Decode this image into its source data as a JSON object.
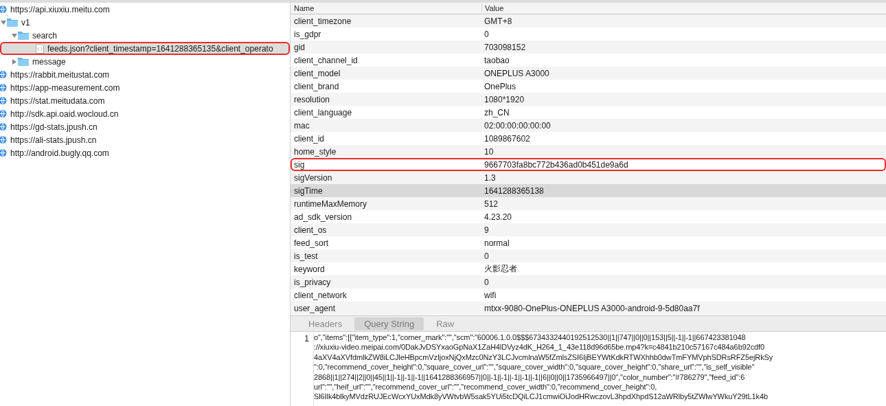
{
  "tree": [
    {
      "label": "https://api.xiuxiu.meitu.com",
      "kind": "host",
      "selected": false,
      "children": [
        {
          "label": "v1",
          "kind": "folder",
          "expanded": true,
          "selected": false,
          "children": [
            {
              "label": "search",
              "kind": "folder",
              "expanded": true,
              "selected": false,
              "children": [
                {
                  "label": "feeds.json?client_timestamp=1641288365135&client_operato",
                  "kind": "file",
                  "selected": true,
                  "highlighted": true
                }
              ]
            },
            {
              "label": "message",
              "kind": "folder",
              "expanded": false,
              "selected": false
            }
          ]
        }
      ]
    },
    {
      "label": "https://rabbit.meitustat.com",
      "kind": "host",
      "selected": false
    },
    {
      "label": "https://app-measurement.com",
      "kind": "host",
      "selected": false
    },
    {
      "label": "https://stat.meitudata.com",
      "kind": "host",
      "selected": false
    },
    {
      "label": "http://sdk.api.oaid.wocloud.cn",
      "kind": "host",
      "selected": false
    },
    {
      "label": "https://gd-stats.jpush.cn",
      "kind": "host",
      "selected": false
    },
    {
      "label": "https://ali-stats.jpush.cn",
      "kind": "host",
      "selected": false
    },
    {
      "label": "http://android.bugly.qq.com",
      "kind": "host",
      "selected": false
    }
  ],
  "table": {
    "columns": [
      "Name",
      "Value"
    ],
    "rows": [
      {
        "name": "client_timezone",
        "value": "GMT+8",
        "selected": false
      },
      {
        "name": "is_gdpr",
        "value": "0",
        "selected": false
      },
      {
        "name": "gid",
        "value": "703098152",
        "selected": false
      },
      {
        "name": "client_channel_id",
        "value": "taobao",
        "selected": false
      },
      {
        "name": "client_model",
        "value": "ONEPLUS A3000",
        "selected": false
      },
      {
        "name": "client_brand",
        "value": "OnePlus",
        "selected": false
      },
      {
        "name": "resolution",
        "value": "1080*1920",
        "selected": false
      },
      {
        "name": "client_language",
        "value": "zh_CN",
        "selected": false
      },
      {
        "name": "mac",
        "value": "02:00:00:00:00:00",
        "selected": false
      },
      {
        "name": "client_id",
        "value": "1089867602",
        "selected": false
      },
      {
        "name": "home_style",
        "value": "10",
        "selected": false
      },
      {
        "name": "sig",
        "value": "9667703fa8bc772b436ad0b451de9a6d",
        "selected": false,
        "highlighted": true
      },
      {
        "name": "sigVersion",
        "value": "1.3",
        "selected": false
      },
      {
        "name": "sigTime",
        "value": "1641288365138",
        "selected": true
      },
      {
        "name": "runtimeMaxMemory",
        "value": "512",
        "selected": false
      },
      {
        "name": "ad_sdk_version",
        "value": "4.23.20",
        "selected": false
      },
      {
        "name": "client_os",
        "value": "9",
        "selected": false
      },
      {
        "name": "feed_sort",
        "value": "normal",
        "selected": false
      },
      {
        "name": "is_test",
        "value": "0",
        "selected": false
      },
      {
        "name": "keyword",
        "value": "火影忍者",
        "selected": false
      },
      {
        "name": "is_privacy",
        "value": "0",
        "selected": false
      },
      {
        "name": "client_network",
        "value": "wifi",
        "selected": false
      },
      {
        "name": "user_agent",
        "value": "mtxx-9080-OnePlus-ONEPLUS A3000-android-9-5d80aa7f",
        "selected": false
      }
    ]
  },
  "tabs": [
    {
      "label": "Headers",
      "selected": false
    },
    {
      "label": "Query String",
      "selected": true
    },
    {
      "label": "Raw",
      "selected": false
    }
  ],
  "code": {
    "line_number": "1",
    "lines": [
      "o\",\"items\":[{\"item_type\":1,\"corner_mark\":\"\",\"scm\":\"60006.1.0.0$$$6734332440192512530||1||747||0||0||153||5||-1||-1||667423381048",
      "://xiuxiu-video.meipai.com/0DakJvDSYxaoGpNaX1ZaH4lDVyz4dK_H264_1_43e118d96d65be.mp4?k=c4841b210c57167c484a6b92cdf0",
      "4aXV4aXVfdmlkZW8iLCJleHBpcmVzIjoxNjQxMzc0NzY3LCJvcmlnaW5fZmlsZSI6IjBEYWtKdkRTWXhhb0dwTmFYMVphSDRsRFZ5ejRkSy",
      "\":0,\"recommend_cover_height\":0,\"square_cover_url\":\"\",\"square_cover_width\":0,\"square_cover_height\":0,\"share_url\":\"\",\"is_self_visible\"",
      "2868||1||274||2||0||45||1||-1||-1||-1||1641288366957||0||-1||-1||-1||-1||-1||6||0||0||1735966497||0\",\"color_number\":\"#786279\",\"feed_id\":6",
      "url\":\"\",\"heif_url\":\"\",\"recommend_cover_url\":\"\",\"recommend_cover_width\":0,\"recommend_cover_height\":0,",
      "Sl6Ilk4blkyMVdzRUJEcWcxYUxMdk8yVWtvbW5sak5YUi5tcDQiLCJ1cmwiOiJodHRwczovL3hpdXhpdS12aWRlby5tZWlwYWkuY29tL1k4b"
    ]
  }
}
